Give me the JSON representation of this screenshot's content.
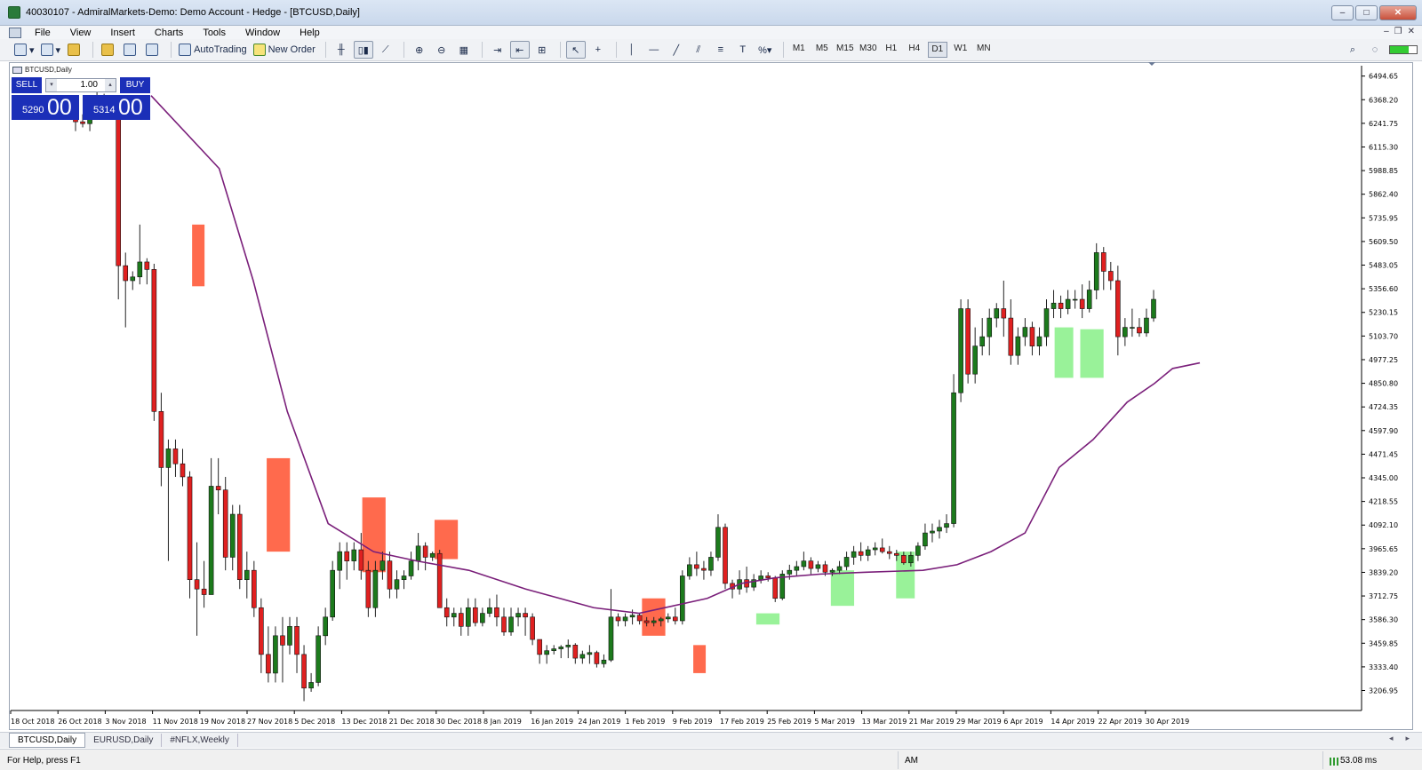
{
  "window": {
    "title": "40030107 - AdmiralMarkets-Demo: Demo Account - Hedge - [BTCUSD,Daily]"
  },
  "menu": [
    "File",
    "View",
    "Insert",
    "Charts",
    "Tools",
    "Window",
    "Help"
  ],
  "toolbar": {
    "autotrading": "AutoTrading",
    "new_order": "New Order",
    "timeframes": [
      "M1",
      "M5",
      "M15",
      "M30",
      "H1",
      "H4",
      "D1",
      "W1",
      "MN"
    ],
    "active_timeframe": "D1"
  },
  "chart_window": {
    "title": "BTCUSD,Daily"
  },
  "trade_panel": {
    "sell_label": "SELL",
    "buy_label": "BUY",
    "lot": "1.00",
    "sell_small": "5290",
    "sell_big": "00",
    "buy_small": "5314",
    "buy_big": "00"
  },
  "chart_data": {
    "type": "candlestick",
    "symbol": "BTCUSD",
    "timeframe": "Daily",
    "ylim": [
      3100,
      6550
    ],
    "y_ticks": [
      "6494.65",
      "6368.20",
      "6241.75",
      "6115.30",
      "5988.85",
      "5862.40",
      "5735.95",
      "5609.50",
      "5483.05",
      "5356.60",
      "5230.15",
      "5103.70",
      "4977.25",
      "4850.80",
      "4724.35",
      "4597.90",
      "4471.45",
      "4345.00",
      "4218.55",
      "4092.10",
      "3965.65",
      "3839.20",
      "3712.75",
      "3586.30",
      "3459.85",
      "3333.40",
      "3206.95"
    ],
    "x_ticks": [
      "18 Oct 2018",
      "26 Oct 2018",
      "3 Nov 2018",
      "11 Nov 2018",
      "19 Nov 2018",
      "27 Nov 2018",
      "5 Dec 2018",
      "13 Dec 2018",
      "21 Dec 2018",
      "30 Dec 2018",
      "8 Jan 2019",
      "16 Jan 2019",
      "24 Jan 2019",
      "1 Feb 2019",
      "9 Feb 2019",
      "17 Feb 2019",
      "25 Feb 2019",
      "5 Mar 2019",
      "13 Mar 2019",
      "21 Mar 2019",
      "29 Mar 2019",
      "6 Apr 2019",
      "14 Apr 2019",
      "22 Apr 2019",
      "30 Apr 2019"
    ],
    "candles": [
      [
        6270,
        6300,
        6200,
        6250
      ],
      [
        6250,
        6290,
        6220,
        6240
      ],
      [
        6240,
        6300,
        6200,
        6280
      ],
      [
        6280,
        6420,
        6260,
        6360
      ],
      [
        6360,
        6400,
        6300,
        6330
      ],
      [
        6330,
        6350,
        6280,
        6300
      ],
      [
        6300,
        5480,
        5300,
        5480
      ],
      [
        5480,
        5550,
        5150,
        5400
      ],
      [
        5400,
        5450,
        5350,
        5420
      ],
      [
        5420,
        5700,
        5380,
        5500
      ],
      [
        5500,
        5520,
        5380,
        5460
      ],
      [
        5460,
        5490,
        4650,
        4700
      ],
      [
        4700,
        4800,
        4300,
        4400
      ],
      [
        4400,
        4550,
        3900,
        4500
      ],
      [
        4500,
        4550,
        4350,
        4420
      ],
      [
        4420,
        4500,
        4300,
        4350
      ],
      [
        4350,
        4380,
        3700,
        3800
      ],
      [
        3800,
        4000,
        3500,
        3750
      ],
      [
        3750,
        3900,
        3650,
        3720
      ],
      [
        3720,
        4450,
        3750,
        4300
      ],
      [
        4300,
        4450,
        4150,
        4280
      ],
      [
        4280,
        4350,
        3850,
        3920
      ],
      [
        3920,
        4200,
        3850,
        4150
      ],
      [
        4150,
        4200,
        3750,
        3800
      ],
      [
        3800,
        3950,
        3700,
        3850
      ],
      [
        3850,
        3900,
        3600,
        3650
      ],
      [
        3650,
        3700,
        3300,
        3400
      ],
      [
        3400,
        3550,
        3250,
        3300
      ],
      [
        3300,
        3550,
        3250,
        3500
      ],
      [
        3500,
        3600,
        3250,
        3450
      ],
      [
        3450,
        3600,
        3400,
        3550
      ],
      [
        3550,
        3600,
        3300,
        3400
      ],
      [
        3400,
        3450,
        3150,
        3220
      ],
      [
        3220,
        3300,
        3200,
        3250
      ],
      [
        3250,
        3550,
        3230,
        3500
      ],
      [
        3500,
        3650,
        3450,
        3600
      ],
      [
        3600,
        3900,
        3580,
        3850
      ],
      [
        3850,
        4000,
        3750,
        3950
      ],
      [
        3950,
        4000,
        3800,
        3900
      ],
      [
        3900,
        4000,
        3850,
        3960
      ],
      [
        3960,
        4050,
        3800,
        3850
      ],
      [
        3850,
        3900,
        3600,
        3650
      ],
      [
        3650,
        3900,
        3600,
        3850
      ],
      [
        3850,
        3950,
        3800,
        3900
      ],
      [
        3900,
        3950,
        3700,
        3750
      ],
      [
        3750,
        3850,
        3700,
        3800
      ],
      [
        3800,
        3850,
        3750,
        3820
      ],
      [
        3820,
        3950,
        3800,
        3900
      ],
      [
        3900,
        4050,
        3850,
        3980
      ],
      [
        3980,
        4000,
        3850,
        3920
      ],
      [
        3920,
        3950,
        3900,
        3940
      ],
      [
        3940,
        3960,
        3650,
        3650
      ],
      [
        3650,
        3700,
        3550,
        3600
      ],
      [
        3600,
        3650,
        3550,
        3620
      ],
      [
        3620,
        3650,
        3500,
        3550
      ],
      [
        3550,
        3700,
        3500,
        3650
      ],
      [
        3650,
        3700,
        3550,
        3570
      ],
      [
        3570,
        3650,
        3550,
        3620
      ],
      [
        3620,
        3700,
        3600,
        3650
      ],
      [
        3650,
        3720,
        3550,
        3600
      ],
      [
        3600,
        3650,
        3500,
        3520
      ],
      [
        3520,
        3650,
        3500,
        3600
      ],
      [
        3600,
        3650,
        3550,
        3620
      ],
      [
        3620,
        3650,
        3500,
        3600
      ],
      [
        3600,
        3620,
        3450,
        3480
      ],
      [
        3480,
        3450,
        3350,
        3400
      ],
      [
        3400,
        3450,
        3350,
        3420
      ],
      [
        3420,
        3450,
        3400,
        3430
      ],
      [
        3430,
        3450,
        3380,
        3440
      ],
      [
        3440,
        3480,
        3380,
        3450
      ],
      [
        3450,
        3460,
        3350,
        3380
      ],
      [
        3380,
        3420,
        3350,
        3400
      ],
      [
        3400,
        3450,
        3350,
        3410
      ],
      [
        3410,
        3420,
        3330,
        3350
      ],
      [
        3350,
        3400,
        3330,
        3370
      ],
      [
        3370,
        3750,
        3360,
        3600
      ],
      [
        3600,
        3620,
        3550,
        3580
      ],
      [
        3580,
        3620,
        3550,
        3600
      ],
      [
        3600,
        3640,
        3560,
        3610
      ],
      [
        3610,
        3620,
        3560,
        3580
      ],
      [
        3580,
        3600,
        3550,
        3570
      ],
      [
        3570,
        3600,
        3550,
        3580
      ],
      [
        3580,
        3600,
        3550,
        3590
      ],
      [
        3590,
        3620,
        3570,
        3600
      ],
      [
        3600,
        3650,
        3560,
        3580
      ],
      [
        3580,
        3850,
        3560,
        3820
      ],
      [
        3820,
        3920,
        3800,
        3880
      ],
      [
        3880,
        3950,
        3820,
        3860
      ],
      [
        3860,
        3900,
        3800,
        3850
      ],
      [
        3850,
        3950,
        3820,
        3920
      ],
      [
        3920,
        4150,
        3900,
        4080
      ],
      [
        4080,
        4100,
        3750,
        3780
      ],
      [
        3780,
        3800,
        3700,
        3750
      ],
      [
        3750,
        3850,
        3720,
        3800
      ],
      [
        3800,
        3870,
        3730,
        3760
      ],
      [
        3760,
        3830,
        3740,
        3800
      ],
      [
        3800,
        3850,
        3780,
        3820
      ],
      [
        3820,
        3840,
        3790,
        3810
      ],
      [
        3810,
        3820,
        3680,
        3700
      ],
      [
        3700,
        3850,
        3690,
        3830
      ],
      [
        3830,
        3880,
        3800,
        3850
      ],
      [
        3850,
        3900,
        3820,
        3870
      ],
      [
        3870,
        3950,
        3850,
        3900
      ],
      [
        3900,
        3920,
        3830,
        3860
      ],
      [
        3860,
        3900,
        3840,
        3880
      ],
      [
        3880,
        3900,
        3820,
        3840
      ],
      [
        3840,
        3860,
        3820,
        3850
      ],
      [
        3850,
        3900,
        3830,
        3870
      ],
      [
        3870,
        3950,
        3850,
        3920
      ],
      [
        3920,
        3980,
        3880,
        3950
      ],
      [
        3950,
        4000,
        3900,
        3930
      ],
      [
        3930,
        3980,
        3900,
        3960
      ],
      [
        3960,
        4000,
        3930,
        3970
      ],
      [
        3970,
        4020,
        3940,
        3950
      ],
      [
        3950,
        3980,
        3910,
        3940
      ],
      [
        3940,
        3960,
        3900,
        3930
      ],
      [
        3930,
        3950,
        3880,
        3890
      ],
      [
        3890,
        3950,
        3870,
        3930
      ],
      [
        3930,
        4000,
        3900,
        3980
      ],
      [
        3980,
        4100,
        3960,
        4050
      ],
      [
        4050,
        4100,
        4000,
        4060
      ],
      [
        4060,
        4120,
        4020,
        4080
      ],
      [
        4080,
        4150,
        4050,
        4100
      ],
      [
        4100,
        4900,
        4080,
        4800
      ],
      [
        4800,
        5300,
        4750,
        5250
      ],
      [
        5250,
        5300,
        4850,
        4900
      ],
      [
        4900,
        5150,
        4850,
        5050
      ],
      [
        5050,
        5200,
        5000,
        5100
      ],
      [
        5100,
        5250,
        5000,
        5200
      ],
      [
        5200,
        5280,
        5150,
        5250
      ],
      [
        5250,
        5400,
        5100,
        5200
      ],
      [
        5200,
        5300,
        4950,
        5000
      ],
      [
        5000,
        5150,
        4950,
        5100
      ],
      [
        5100,
        5200,
        5050,
        5150
      ],
      [
        5150,
        5180,
        5000,
        5050
      ],
      [
        5050,
        5150,
        5000,
        5100
      ],
      [
        5100,
        5300,
        5050,
        5250
      ],
      [
        5250,
        5350,
        5200,
        5280
      ],
      [
        5280,
        5320,
        5200,
        5250
      ],
      [
        5250,
        5350,
        5220,
        5300
      ],
      [
        5300,
        5350,
        5250,
        5300
      ],
      [
        5300,
        5380,
        5200,
        5250
      ],
      [
        5250,
        5400,
        5230,
        5350
      ],
      [
        5350,
        5600,
        5300,
        5550
      ],
      [
        5550,
        5580,
        5350,
        5450
      ],
      [
        5450,
        5500,
        5350,
        5400
      ],
      [
        5400,
        5480,
        5000,
        5100
      ],
      [
        5100,
        5200,
        5050,
        5150
      ],
      [
        5150,
        5250,
        5100,
        5150
      ],
      [
        5150,
        5200,
        5100,
        5120
      ],
      [
        5120,
        5250,
        5100,
        5200
      ],
      [
        5200,
        5350,
        5180,
        5300
      ]
    ],
    "moving_average": [
      [
        0,
        6390
      ],
      [
        0.3,
        6000
      ],
      [
        0.45,
        5400
      ],
      [
        0.6,
        4700
      ],
      [
        0.78,
        4100
      ],
      [
        0.98,
        3950
      ],
      [
        1.17,
        3900
      ],
      [
        1.4,
        3850
      ],
      [
        1.65,
        3750
      ],
      [
        1.95,
        3650
      ],
      [
        2.15,
        3620
      ],
      [
        2.3,
        3660
      ],
      [
        2.45,
        3700
      ],
      [
        2.6,
        3780
      ],
      [
        2.75,
        3810
      ],
      [
        2.95,
        3830
      ],
      [
        3.15,
        3840
      ],
      [
        3.4,
        3850
      ],
      [
        3.55,
        3880
      ],
      [
        3.7,
        3950
      ],
      [
        3.85,
        4050
      ],
      [
        4.0,
        4400
      ],
      [
        4.15,
        4550
      ],
      [
        4.3,
        4750
      ],
      [
        4.42,
        4850
      ],
      [
        4.5,
        4930
      ],
      [
        4.62,
        4960
      ]
    ],
    "highlights": [
      {
        "color": "red",
        "x0": 0.5,
        "x1": 0.55,
        "y0": 5370,
        "y1": 5700
      },
      {
        "color": "red",
        "x0": 0.82,
        "x1": 0.92,
        "y0": 3950,
        "y1": 4450
      },
      {
        "color": "red",
        "x0": 1.23,
        "x1": 1.33,
        "y0": 3840,
        "y1": 4240
      },
      {
        "color": "red",
        "x0": 1.54,
        "x1": 1.64,
        "y0": 3910,
        "y1": 4120
      },
      {
        "color": "red",
        "x0": 2.43,
        "x1": 2.53,
        "y0": 3500,
        "y1": 3700
      },
      {
        "color": "red",
        "x0": 2.65,
        "x1": 2.7,
        "y0": 3300,
        "y1": 3450
      },
      {
        "color": "green",
        "x0": 2.92,
        "x1": 3.02,
        "y0": 3560,
        "y1": 3620
      },
      {
        "color": "green",
        "x0": 3.24,
        "x1": 3.34,
        "y0": 3660,
        "y1": 3850
      },
      {
        "color": "green",
        "x0": 3.52,
        "x1": 3.6,
        "y0": 3700,
        "y1": 3950
      },
      {
        "color": "green",
        "x0": 4.2,
        "x1": 4.28,
        "y0": 4880,
        "y1": 5150
      },
      {
        "color": "green",
        "x0": 4.31,
        "x1": 4.41,
        "y0": 4880,
        "y1": 5140
      }
    ]
  },
  "tabs": [
    "BTCUSD,Daily",
    "EURUSD,Daily",
    "#NFLX,Weekly"
  ],
  "status": {
    "help": "For Help, press F1",
    "mode": "AM",
    "ping": "53.08 ms"
  },
  "colors": {
    "bull": "#1c7a1c",
    "bear": "#e02020",
    "ma": "#7a1f7a",
    "red_zone": "#ff5a3a",
    "green_zone": "#77ee77"
  }
}
